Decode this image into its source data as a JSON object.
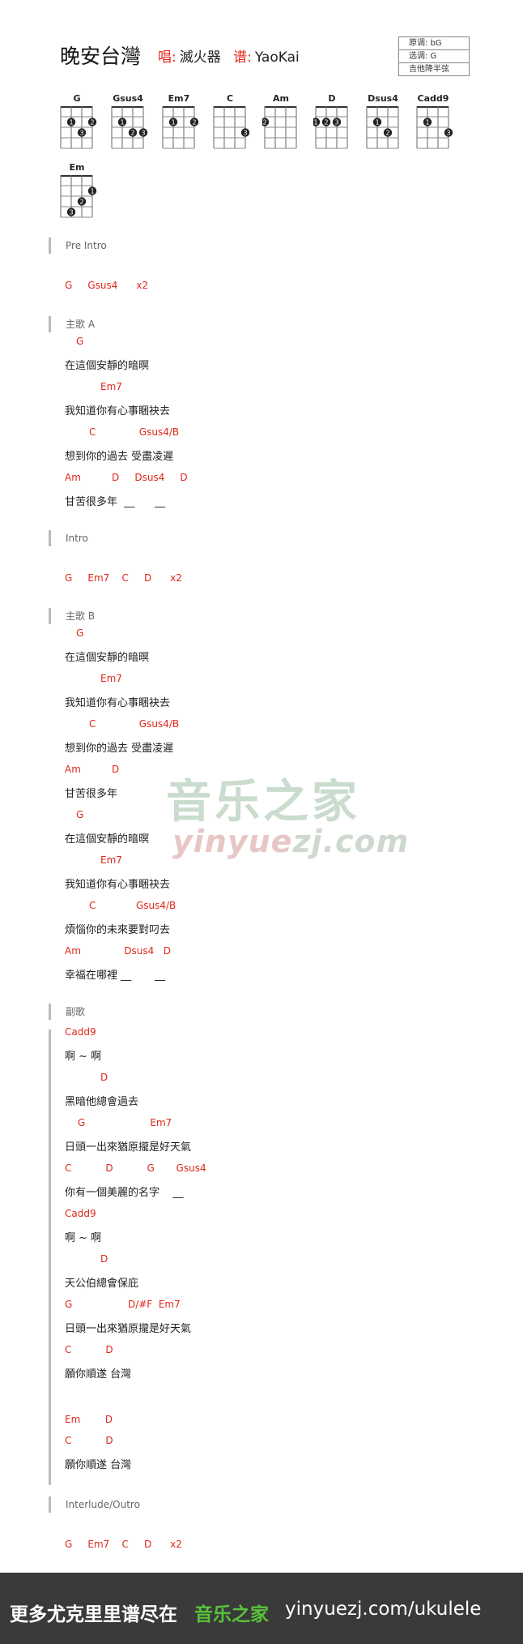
{
  "header": {
    "title": "晚安台灣",
    "singer_label": "唱:",
    "singer": "滅火器",
    "tab_label": "谱:",
    "tabber": "YaoKai",
    "key_info": [
      "原调: bG",
      "选调: G",
      "吉他降半弦"
    ]
  },
  "chord_diagrams": [
    {
      "name": "G"
    },
    {
      "name": "Gsus4"
    },
    {
      "name": "Em7"
    },
    {
      "name": "C"
    },
    {
      "name": "Am"
    },
    {
      "name": "D"
    },
    {
      "name": "Dsus4"
    },
    {
      "name": "Cadd9"
    },
    {
      "name": "Em"
    }
  ],
  "sections": {
    "pre_intro": "Pre Intro",
    "verse_a": "主歌 A",
    "intro": "Intro",
    "verse_b": "主歌 B",
    "chorus": "副歌",
    "outro": "Interlude/Outro"
  },
  "lines": {
    "c1": "G     Gsus4      x2",
    "a_c1": "G",
    "a_l1": "在這個安靜的暗暝",
    "a_c2": "Em7",
    "a_l2": "我知道你有心事睏袂去",
    "a_c3": "C              Gsus4/B",
    "a_l3": "想到你的過去 受盡凌遲",
    "a_c4": "Am          D     Dsus4     D",
    "a_l4": "甘苦很多年  __      __",
    "i_c1": "G     Em7    C     D      x2",
    "b_c1": "G",
    "b_l1": "在這個安靜的暗暝",
    "b_c2": "Em7",
    "b_l2": "我知道你有心事睏袂去",
    "b_c3": "C              Gsus4/B",
    "b_l3": "想到你的過去 受盡凌遲",
    "b_c4": "Am          D",
    "b_l4": "甘苦很多年",
    "b_c5": "G",
    "b_l5": "在這個安靜的暗暝",
    "b_c6": "Em7",
    "b_l6": "我知道你有心事睏袂去",
    "b_c7": "C             Gsus4/B",
    "b_l7": "煩惱你的未來要對叼去",
    "b_c8": "Am              Dsus4   D",
    "b_l8": "幸福在哪裡 __       __",
    "r_c1": "Cadd9",
    "r_l1": "啊 ~ 啊",
    "r_c2": "D",
    "r_l2": "黑暗他總會過去",
    "r_c3": "G                     Em7",
    "r_l3": "日頭一出來猶原攏是好天氣",
    "r_c4": "C           D           G       Gsus4",
    "r_l4": "你有一個美麗的名字    __",
    "r_c5": "Cadd9",
    "r_l5": "啊 ~ 啊",
    "r_c6": "D",
    "r_l6": "天公伯總會保庇",
    "r_c7": "G                  D/#F  Em7",
    "r_l7": "日頭一出來猶原攏是好天氣",
    "r_c8": "C           D",
    "r_l8": "願你順遂 台灣",
    "r_c9": "Em        D",
    "r_c10": "C           D",
    "r_l9": "願你順遂 台灣",
    "o_c1": "G     Em7    C     D      x2"
  },
  "watermark": {
    "cn": "音乐之家",
    "url_a": "yinyue",
    "url_b": "zj.com"
  },
  "footer": {
    "text": "更多尤克里里谱尽在",
    "brand": "音乐之家",
    "url": "yinyuezj.com/ukulele"
  },
  "colors": {
    "chord": "#e0261b",
    "brand_green": "#58c23a",
    "footer_bg": "#3a3a3a"
  }
}
